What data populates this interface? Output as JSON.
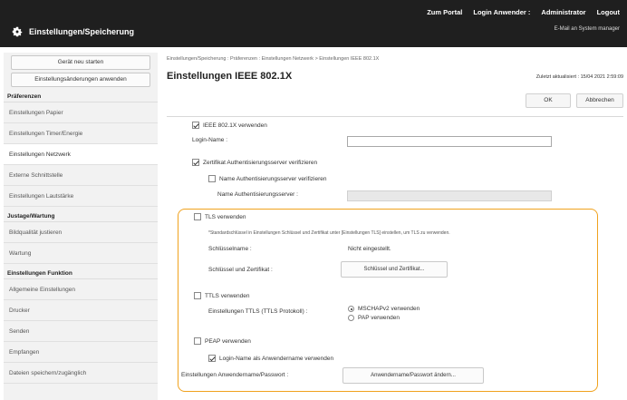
{
  "header": {
    "links": [
      "Zum Portal",
      "Login Anwender :",
      "Administrator",
      "Logout"
    ],
    "mail": "E-Mail an System manager",
    "app_title": "Einstellungen/Speicherung"
  },
  "sidebar": {
    "buttons": [
      "Gerät neu starten",
      "Einstellungsänderungen anwenden"
    ],
    "sections": [
      {
        "title": "Präferenzen",
        "items": [
          "Einstellungen Papier",
          "Einstellungen Timer/Energie",
          "Einstellungen Netzwerk",
          "Externe Schnittstelle",
          "Einstellungen Lautstärke"
        ]
      },
      {
        "title": "Justage/Wartung",
        "items": [
          "Bildqualität justieren",
          "Wartung"
        ]
      },
      {
        "title": "Einstellungen Funktion",
        "items": [
          "Allgemeine Einstellungen",
          "Drucker",
          "Senden",
          "Empfangen",
          "Dateien speichern/zugänglich"
        ]
      }
    ],
    "active_item": "Einstellungen Netzwerk"
  },
  "main": {
    "breadcrumb": "Einstellungen/Speicherung : Präferenzen : Einstellungen Netzwerk > Einstellungen IEEE 802.1X",
    "title": "Einstellungen IEEE 802.1X",
    "updated": "Zuletzt aktualisiert : 15/04 2021 2:59:09",
    "ok_label": "OK",
    "cancel_label": "Abbrechen",
    "use_8021x": "IEEE 802.1X verwenden",
    "login_name_label": "Login-Name :",
    "verify_cert": "Zertifikat Authentisierungsserver verifizieren",
    "verify_name": "Name Authentisierungsserver verifizieren",
    "auth_server_name_label": "Name Authentisierungsserver :",
    "tls_use": "TLS verwenden",
    "tls_note": "*Standardschlüssel in Einstellungen Schlüssel und Zertifikat unter [Einstellungen TLS] einstellen, um TLS zu verwenden.",
    "key_name_label": "Schlüsselname :",
    "key_name_value": "Nicht eingestellt.",
    "key_cert_label": "Schlüssel und Zertifikat :",
    "key_cert_button": "Schlüssel und Zertifikat...",
    "ttls_use": "TTLS verwenden",
    "ttls_settings_label": "Einstellungen TTLS (TTLS Protokoll) :",
    "ttls_options": [
      "MSCHAPv2 verwenden",
      "PAP verwenden"
    ],
    "peap_use": "PEAP verwenden",
    "login_as_user": "Login-Name als Anwendername verwenden",
    "user_pw_label": "Einstellungen Anwendername/Passwort :",
    "user_pw_button": "Anwendername/Passwort ändern..."
  },
  "colors": {
    "header_bg": "#1f1f1f",
    "highlight_border": "#f0a21e",
    "sidebar_bg": "#f2f2f2"
  }
}
